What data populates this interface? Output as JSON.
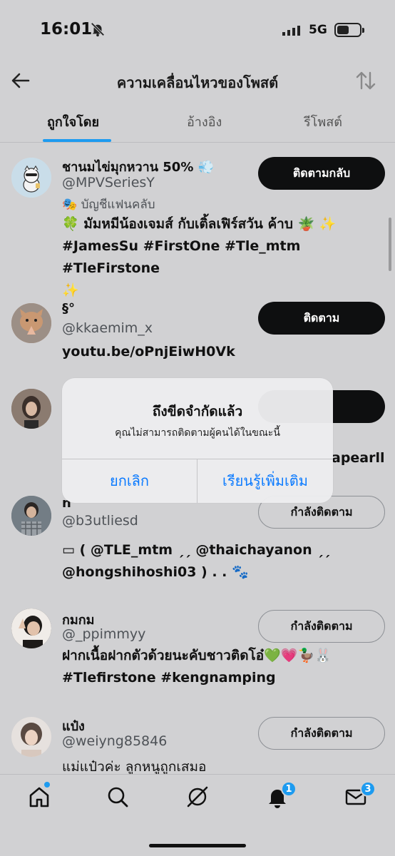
{
  "status_bar": {
    "time": "16:01",
    "network": "5G"
  },
  "header": {
    "title": "ความเคลื่อนไหวของโพสต์"
  },
  "tabs": [
    {
      "label": "ถูกใจโดย"
    },
    {
      "label": "อ้างอิง"
    },
    {
      "label": "รีโพสต์"
    }
  ],
  "users": [
    {
      "name": "ชานมไข่มุกหวาน 50% 💨",
      "handle": "@MPVSeriesY",
      "fan_label": "🎭 บัญชีแฟนคลับ",
      "bio_line1": "🍀 มัมหมีน้องเจมส์ กับเติ้ลเฟิร์สวัน ค้าบ 🪴 ✨",
      "bio_line2": "#JamesSu #FirstOne #Tle_mtm #TleFirstone",
      "bio_line3": "✨",
      "button": "ติดตามกลับ"
    },
    {
      "name": "§°",
      "handle": "@kkaemim_x",
      "bio_line1": "youtu.be/oPnjEiwH0Vk",
      "button": "ติดตาม"
    },
    {
      "name": "",
      "handle": "",
      "bio_partial": "apearll"
    },
    {
      "name": "n",
      "handle": "@b3utliesd",
      "bio_line1": "▭ ( @TLE_mtm ˏˏ @thaichayanon ˏˏ",
      "bio_line2": "@hongshihoshi03 ) . . 🐾",
      "button": "กำลังติดตาม"
    },
    {
      "name": "กมกม",
      "handle": "@_ppimmyy",
      "bio_line1": "ฝากเนื้อฝากตัวด้วยนะคับชาวติดโอ๋💚💗🦆🐰",
      "bio_line2": "#Tlefirstone #kengnamping",
      "button": "กำลังติดตาม"
    },
    {
      "name": "แป๋ง",
      "handle": "@weiyng85846",
      "bio_line1": "แม่แป๋วค่ะ ลูกหนูถูกเสมอ",
      "button": "กำลังติดตาม"
    }
  ],
  "dialog": {
    "title": "ถึงขีดจำกัดแล้ว",
    "message": "คุณไม่สามารถติดตามผู้คนได้ในขณะนี้",
    "cancel": "ยกเลิก",
    "learn_more": "เรียนรู้เพิ่มเติม"
  },
  "bottom_nav": {
    "notifications_badge": "1",
    "messages_badge": "3"
  },
  "colors": {
    "accent": "#1d9bf0",
    "ios_link": "#0a7aff",
    "dark_button": "#0e0f10"
  }
}
